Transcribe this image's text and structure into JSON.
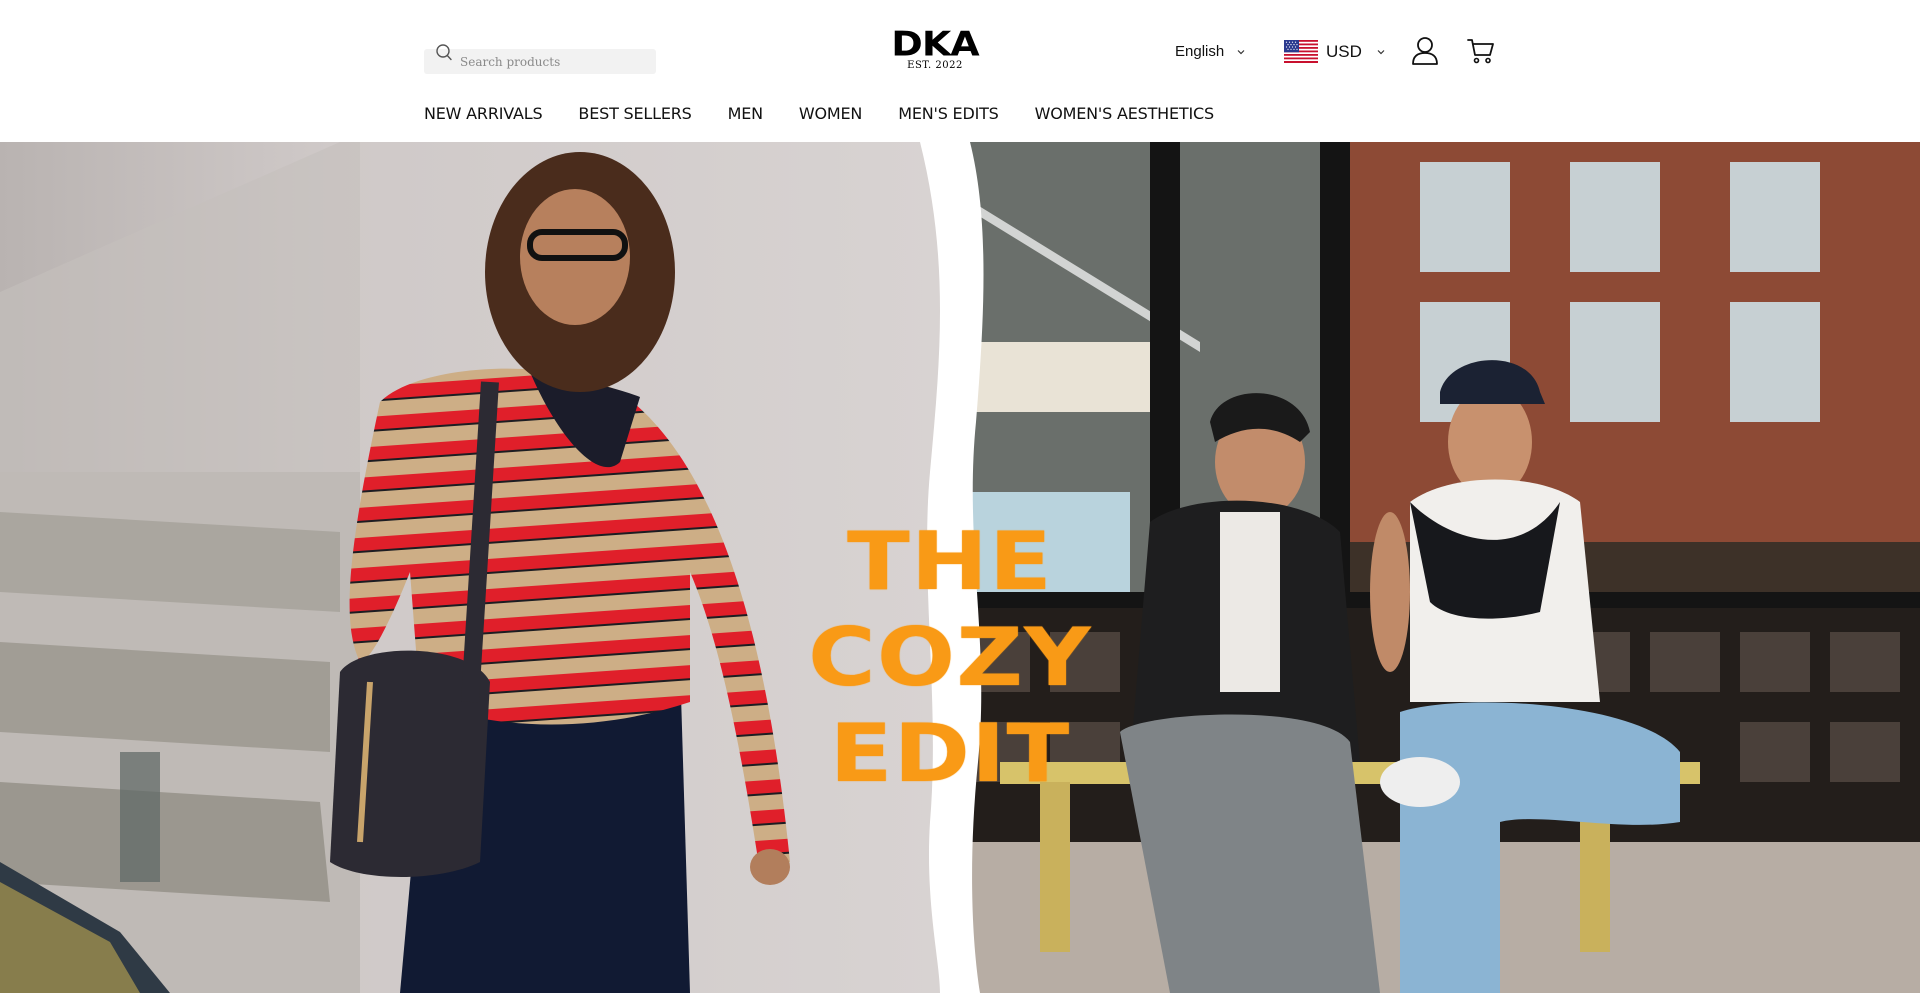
{
  "header": {
    "search": {
      "placeholder": "Search products"
    },
    "logo": {
      "mark": "DKA",
      "tagline": "EST. 2022"
    },
    "language": {
      "selected": "English"
    },
    "currency": {
      "selected": "USD",
      "flag_icon": "us-flag-icon"
    },
    "icons": {
      "account": "user-icon",
      "cart": "cart-icon",
      "search": "search-icon"
    }
  },
  "nav": {
    "items": [
      {
        "label": "NEW ARRIVALS"
      },
      {
        "label": "BEST SELLERS"
      },
      {
        "label": "MEN"
      },
      {
        "label": "WOMEN"
      },
      {
        "label": "MEN'S EDITS"
      },
      {
        "label": "WOMEN'S AESTHETICS"
      }
    ]
  },
  "hero": {
    "headline": [
      "THE",
      "COZY",
      "EDIT"
    ],
    "colors": {
      "headline": "#f99a16",
      "divider": "#ffffff"
    }
  }
}
